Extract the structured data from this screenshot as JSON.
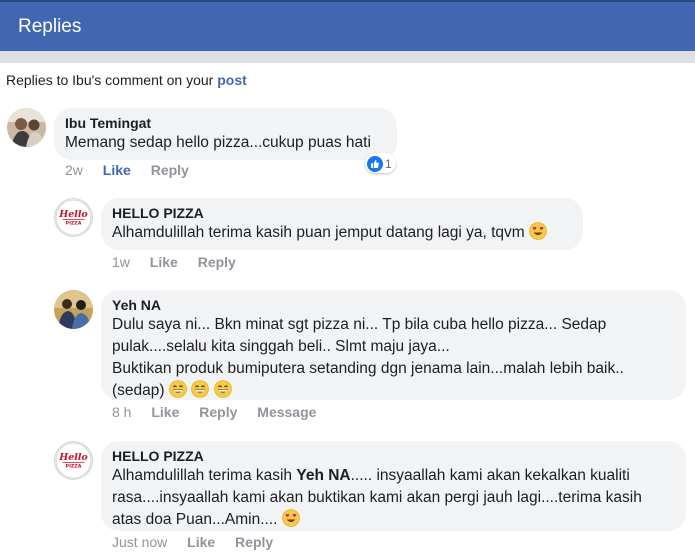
{
  "header": {
    "title": "Replies"
  },
  "subline": {
    "prefix": "Replies to Ibu's comment on your ",
    "link": "post"
  },
  "comments": [
    {
      "author": "Ibu Temingat",
      "text": "Memang sedap hello pizza...cukup puas hati",
      "time": "2w",
      "like": "Like",
      "reply": "Reply",
      "reaction_count": "1"
    },
    {
      "author": "HELLO PIZZA",
      "text": "Alhamdulillah terima kasih puan jemput datang lagi ya, tqvm",
      "time": "1w",
      "like": "Like",
      "reply": "Reply"
    },
    {
      "author": "Yeh NA",
      "line1": "Dulu saya ni... Bkn minat sgt pizza ni... Tp bila cuba hello pizza... Sedap",
      "line2": "pulak....selalu kita singgah beli.. Slmt maju jaya...",
      "line3": "Buktikan produk bumiputera setanding dgn jenama lain...malah lebih baik..",
      "line4": "(sedap)",
      "time": "8 h",
      "like": "Like",
      "reply": "Reply",
      "message": "Message"
    },
    {
      "author": "HELLO PIZZA",
      "line1_prefix": "Alhamdulillah terima kasih ",
      "line1_mention": "Yeh NA",
      "line1_suffix": "..... insyaallah kami akan kekalkan kualiti",
      "line2": "rasa....insyaallah kami akan buktikan kami akan pergi jauh lagi....terima kasih",
      "line3": "atas doa Puan...Amin....",
      "time": "Just now",
      "like": "Like",
      "reply": "Reply"
    }
  ],
  "logo": {
    "line1": "Hello",
    "line2": "PIZZA"
  },
  "icons": {
    "heart_eyes": "heart-eyes-emoji",
    "grin": "grinning-emoji",
    "like_reaction": "thumbs-up-icon"
  },
  "colors": {
    "brand": "#4267b2",
    "bubble": "#f2f3f5",
    "meta": "#90949c"
  }
}
